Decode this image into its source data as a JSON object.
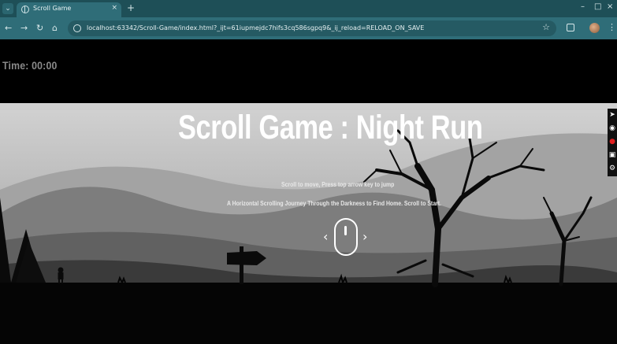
{
  "browser": {
    "tab_title": "Scroll Game",
    "url": "localhost:63342/Scroll-Game/index.html?_ijt=61iupmejdc7hifs3cq586sgpq9&_ij_reload=RELOAD_ON_SAVE",
    "icons": {
      "tab_search": "⌄",
      "tab_close": "×",
      "new_tab": "+",
      "minimize": "–",
      "maximize": "□",
      "close": "×",
      "back": "←",
      "forward": "→",
      "reload": "↻",
      "home": "⌂",
      "bookmark": "☆",
      "menu": "⋮"
    }
  },
  "game": {
    "timer": "Time: 00:00",
    "title": "Scroll Game : Night Run",
    "instructions": "Scroll to move, Press top arrow key to jump",
    "subtitle": "A Horizontal Scrolling Journey Through the Darkness to Find Home. Scroll to Start.",
    "scroll_arrows": {
      "left": "‹",
      "right": "›"
    }
  },
  "side_toolbar": {
    "icons": [
      "pointer-icon",
      "camera-icon",
      "record-icon",
      "image-icon",
      "settings-icon"
    ],
    "glyphs": [
      "➤",
      "◉",
      "●",
      "▣",
      "⚙"
    ]
  },
  "colors": {
    "tab_bar": "#1e4f57",
    "toolbar": "#2f6d78",
    "page_bg": "#000000",
    "title_text": "#ffffff",
    "timer_text": "#8a8a8a"
  }
}
